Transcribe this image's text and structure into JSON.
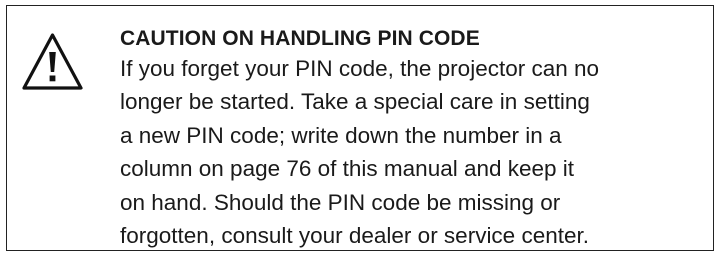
{
  "notice": {
    "icon": "warning-triangle-icon",
    "heading": "CAUTION ON HANDLING PIN CODE",
    "lines": [
      "If you forget your PIN code, the projector can no",
      "longer be started. Take a special care in setting",
      "a new PIN code; write down the number in a",
      "column on page 76 of this manual and keep it",
      "on hand. Should the PIN code be missing or",
      "forgotten, consult your dealer or service center."
    ]
  }
}
